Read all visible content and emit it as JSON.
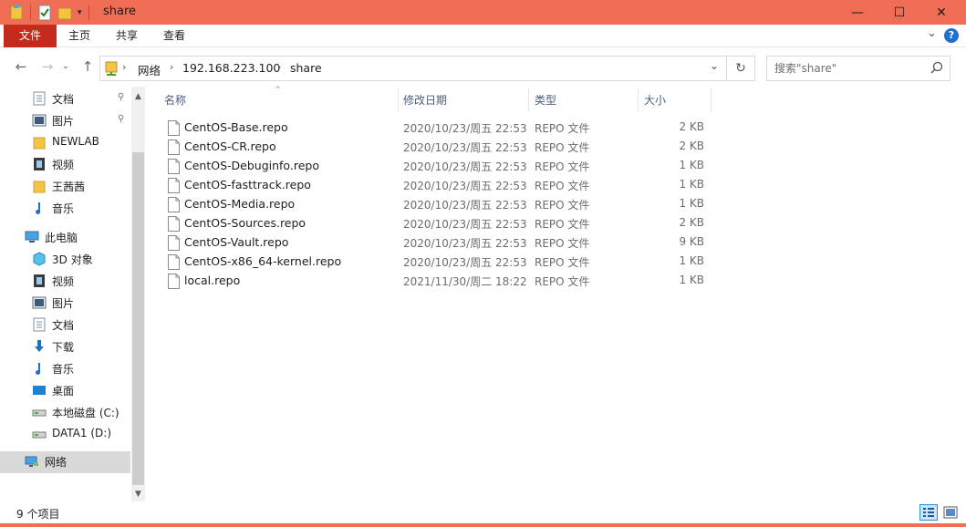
{
  "window": {
    "title": "share",
    "minimize_symbol": "—",
    "maximize_symbol": "☐",
    "close_symbol": "✕",
    "accent": "#ef6d54"
  },
  "ribbon": {
    "tabs": [
      {
        "label": "文件",
        "active": true
      },
      {
        "label": "主页"
      },
      {
        "label": "共享"
      },
      {
        "label": "查看"
      }
    ],
    "expand_symbol": "⌄",
    "help_symbol": "?"
  },
  "nav": {
    "back_symbol": "←",
    "forward_symbol": "→",
    "recent_symbol": "⌄",
    "up_symbol": "↑",
    "refresh_symbol": "↻",
    "dropdown_symbol": "⌄",
    "breadcrumb": [
      "网络",
      "192.168.223.100",
      "share"
    ],
    "search_placeholder": "搜索\"share\""
  },
  "sidebar": {
    "items": [
      {
        "label": "文档",
        "icon": "documents-icon",
        "pinned": true
      },
      {
        "label": "图片",
        "icon": "pictures-icon",
        "pinned": true
      },
      {
        "label": "NEWLAB",
        "icon": "folder-icon"
      },
      {
        "label": "视频",
        "icon": "videos-icon"
      },
      {
        "label": "王茜茜",
        "icon": "folder-icon"
      },
      {
        "label": "音乐",
        "icon": "music-icon"
      },
      {
        "label": "此电脑",
        "icon": "computer-icon"
      },
      {
        "label": "3D 对象",
        "icon": "3d-objects-icon"
      },
      {
        "label": "视频",
        "icon": "videos-icon"
      },
      {
        "label": "图片",
        "icon": "pictures-icon"
      },
      {
        "label": "文档",
        "icon": "documents-icon"
      },
      {
        "label": "下载",
        "icon": "downloads-icon"
      },
      {
        "label": "音乐",
        "icon": "music-icon"
      },
      {
        "label": "桌面",
        "icon": "desktop-icon"
      },
      {
        "label": "本地磁盘 (C:)",
        "icon": "drive-icon"
      },
      {
        "label": "DATA1 (D:)",
        "icon": "drive-icon"
      },
      {
        "label": "网络",
        "icon": "network-icon",
        "selected": true
      }
    ],
    "pin_symbol": "📌",
    "scroll_up_symbol": "▲",
    "scroll_down_symbol": "▼"
  },
  "file_list": {
    "columns": [
      {
        "label": "名称"
      },
      {
        "label": "修改日期"
      },
      {
        "label": "类型"
      },
      {
        "label": "大小"
      }
    ],
    "sort_symbol": "^",
    "rows": [
      {
        "name": "CentOS-Base.repo",
        "date": "2020/10/23/周五 22:53",
        "type": "REPO 文件",
        "size": "2 KB"
      },
      {
        "name": "CentOS-CR.repo",
        "date": "2020/10/23/周五 22:53",
        "type": "REPO 文件",
        "size": "2 KB"
      },
      {
        "name": "CentOS-Debuginfo.repo",
        "date": "2020/10/23/周五 22:53",
        "type": "REPO 文件",
        "size": "1 KB"
      },
      {
        "name": "CentOS-fasttrack.repo",
        "date": "2020/10/23/周五 22:53",
        "type": "REPO 文件",
        "size": "1 KB"
      },
      {
        "name": "CentOS-Media.repo",
        "date": "2020/10/23/周五 22:53",
        "type": "REPO 文件",
        "size": "1 KB"
      },
      {
        "name": "CentOS-Sources.repo",
        "date": "2020/10/23/周五 22:53",
        "type": "REPO 文件",
        "size": "2 KB"
      },
      {
        "name": "CentOS-Vault.repo",
        "date": "2020/10/23/周五 22:53",
        "type": "REPO 文件",
        "size": "9 KB"
      },
      {
        "name": "CentOS-x86_64-kernel.repo",
        "date": "2020/10/23/周五 22:53",
        "type": "REPO 文件",
        "size": "1 KB"
      },
      {
        "name": "local.repo",
        "date": "2021/11/30/周二 18:22",
        "type": "REPO 文件",
        "size": "1 KB"
      }
    ]
  },
  "status": {
    "item_count": "9 个项目"
  }
}
